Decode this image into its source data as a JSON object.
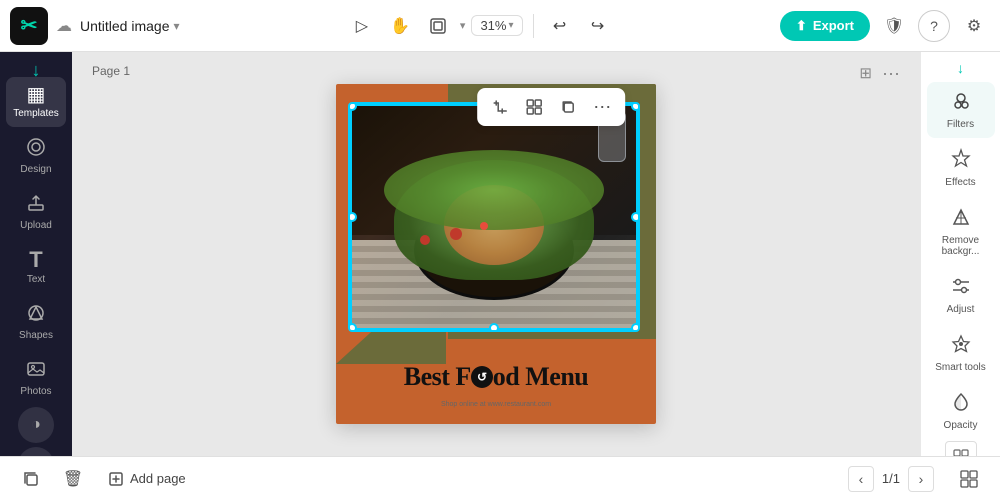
{
  "app": {
    "logo_symbol": "✂",
    "title": "Untitled image",
    "title_chevron": "▾"
  },
  "topbar": {
    "cloud_icon": "☁",
    "tools": [
      {
        "id": "pointer",
        "icon": "▷",
        "label": "Pointer"
      },
      {
        "id": "hand",
        "icon": "✋",
        "label": "Hand"
      },
      {
        "id": "layout",
        "icon": "⊟",
        "label": "Layout"
      },
      {
        "id": "zoom",
        "value": "31%",
        "chevron": "▾"
      },
      {
        "id": "undo",
        "icon": "↩",
        "label": "Undo"
      },
      {
        "id": "redo",
        "icon": "↪",
        "label": "Redo"
      }
    ],
    "export_label": "Export",
    "export_icon": "⬆",
    "shield_icon": "🛡",
    "help_icon": "?",
    "settings_icon": "⚙"
  },
  "left_sidebar": {
    "arrow_down": "↓",
    "items": [
      {
        "id": "templates",
        "icon": "▦",
        "label": "Templates",
        "active": true
      },
      {
        "id": "design",
        "icon": "✦",
        "label": "Design"
      },
      {
        "id": "upload",
        "icon": "⬆",
        "label": "Upload"
      },
      {
        "id": "text",
        "icon": "T",
        "label": "Text"
      },
      {
        "id": "shapes",
        "icon": "⬡",
        "label": "Shapes"
      },
      {
        "id": "photos",
        "icon": "🖼",
        "label": "Photos"
      }
    ],
    "bottom_icon": "◑",
    "bottom_chevron": "˅"
  },
  "canvas": {
    "page_label": "Page 1",
    "page_icon": "⊞",
    "more_icon": "⋯",
    "toolbar_icons": [
      "⊡",
      "⊞",
      "⊟",
      "⋯"
    ],
    "design": {
      "title": "Best Food Menu",
      "subtitle": "Shop online at www.restaurant.com",
      "title_icon": "↺"
    }
  },
  "right_sidebar": {
    "arrow_label": "↓",
    "items": [
      {
        "id": "filters",
        "icon": "👤",
        "label": "Filters"
      },
      {
        "id": "effects",
        "icon": "✦",
        "label": "Effects"
      },
      {
        "id": "remove-bg",
        "icon": "✂",
        "label": "Remove backgr..."
      },
      {
        "id": "adjust",
        "icon": "⊟",
        "label": "Adjust"
      },
      {
        "id": "smart-tools",
        "icon": "✧",
        "label": "Smart tools"
      },
      {
        "id": "opacity",
        "icon": "◎",
        "label": "Opacity"
      }
    ],
    "bottom_icon": "⊞"
  },
  "bottom_bar": {
    "copy_icon": "⊟",
    "trash_icon": "🗑",
    "add_page_label": "Add page",
    "page_current": "1",
    "page_total": "1",
    "nav_prev": "‹",
    "nav_next": "›",
    "grid_icon": "⊞"
  }
}
